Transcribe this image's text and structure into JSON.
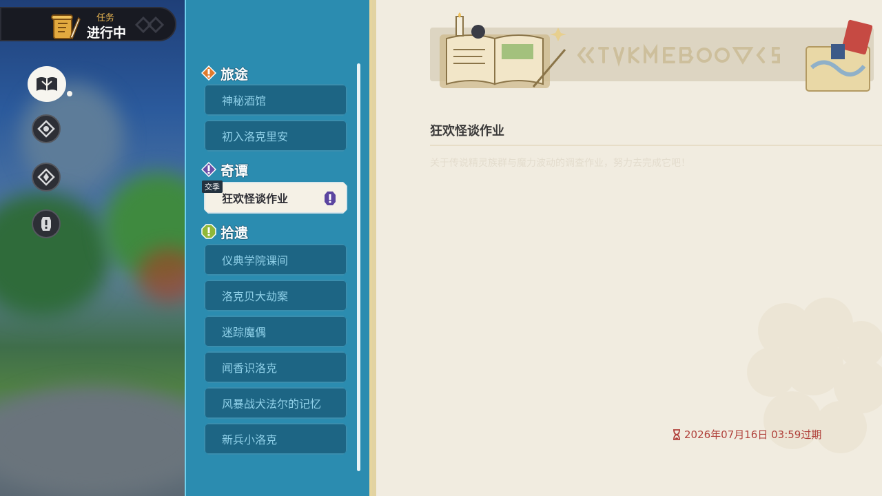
{
  "hud": {
    "category": "任务",
    "status": "进行中"
  },
  "side_nav": {
    "icons": [
      "open-book-icon",
      "compass-icon",
      "compass-icon",
      "exclamation-icon"
    ]
  },
  "quest_groups": [
    {
      "title": "旅途",
      "icon": "orange-exclamation-icon",
      "color": "#e07a2c",
      "items": [
        "神秘酒馆",
        "初入洛克里安"
      ]
    },
    {
      "title": "奇谭",
      "icon": "purple-exclamation-icon",
      "color": "#6a4fa8",
      "tag": "交季",
      "items": [
        "狂欢怪谈作业"
      ]
    },
    {
      "title": "拾遗",
      "icon": "green-exclamation-icon",
      "color": "#8fb83a",
      "items": [
        "仪典学院课间",
        "洛克贝大劫案",
        "迷踪魔偶",
        "闻香识洛克",
        "风暴战犬法尔的记忆",
        "新兵小洛克"
      ]
    }
  ],
  "selected_quest": {
    "title": "狂欢怪谈作业",
    "description": "关于传说精灵族群与魔力波动的调查作业，努力去完成它吧！",
    "expiry": "2026年07月16日 03:59过期"
  },
  "colors": {
    "panel": "#2b8cb0",
    "item": "#1d6584",
    "details_bg": "#f1ece0",
    "expiry": "#b0403a"
  }
}
